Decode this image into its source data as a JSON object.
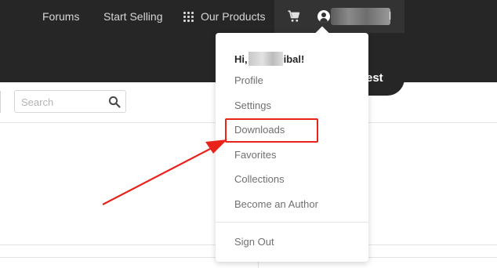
{
  "header": {
    "nav": [
      "Forums",
      "Start Selling",
      "Our Products"
    ],
    "user_suffix": "l",
    "pill_text": "orest"
  },
  "search": {
    "placeholder": "Search"
  },
  "user_menu": {
    "greeting_start": "Hi,",
    "greeting_end": "ibal!",
    "items": [
      "Profile",
      "Settings",
      "Downloads",
      "Favorites",
      "Collections",
      "Become an Author"
    ],
    "sign_out": "Sign Out"
  },
  "colors": {
    "header_bg": "#262626",
    "annotation": "#e8231b"
  },
  "icons": [
    "grid-icon",
    "cart-icon",
    "user-icon",
    "search-icon"
  ]
}
